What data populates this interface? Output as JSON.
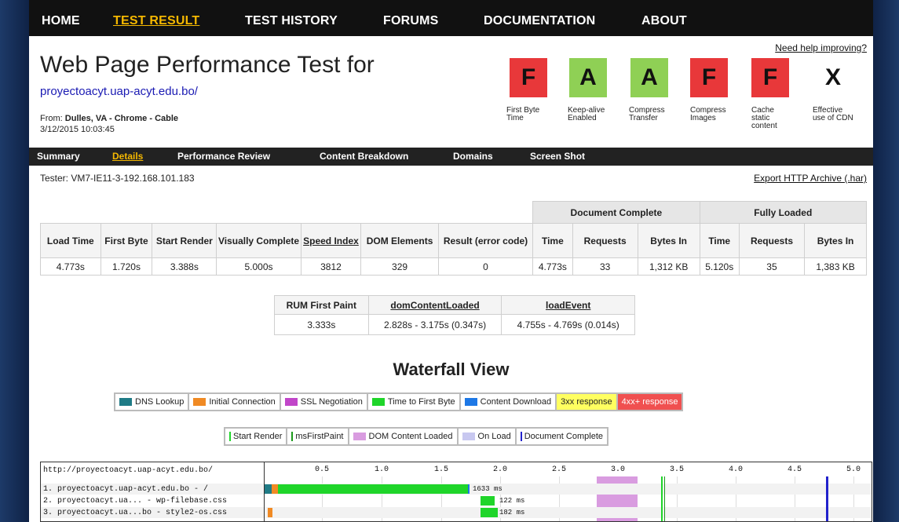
{
  "nav": {
    "home": "HOME",
    "test_result": "TEST RESULT",
    "test_history": "TEST HISTORY",
    "forums": "FORUMS",
    "documentation": "DOCUMENTATION",
    "about": "ABOUT"
  },
  "header": {
    "title": "Web Page Performance Test for",
    "url": "proyectoacyt.uap-acyt.edu.bo/",
    "from_label": "From: ",
    "from_value": "Dulles, VA - Chrome - Cable",
    "date": "3/12/2015 10:03:45",
    "help_link": "Need help improving?"
  },
  "grades": [
    {
      "grade": "F",
      "label": "First Byte Time",
      "color": "#e8383a"
    },
    {
      "grade": "A",
      "label": "Keep-alive Enabled",
      "color": "#8fd055"
    },
    {
      "grade": "A",
      "label": "Compress Transfer",
      "color": "#8fd055"
    },
    {
      "grade": "F",
      "label": "Compress Images",
      "color": "#e8383a"
    },
    {
      "grade": "F",
      "label": "Cache static content",
      "color": "#e8383a"
    },
    {
      "grade": "X",
      "label": "Effective use of CDN",
      "color": "#ffffff"
    }
  ],
  "subnav": {
    "summary": "Summary",
    "details": "Details",
    "performance_review": "Performance Review",
    "content_breakdown": "Content Breakdown",
    "domains": "Domains",
    "screen_shot": "Screen Shot"
  },
  "tester": "Tester: VM7-IE11-3-192.168.101.183",
  "export_link": "Export HTTP Archive (.har)",
  "results": {
    "group_doc": "Document Complete",
    "group_full": "Fully Loaded",
    "headers": {
      "load_time": "Load Time",
      "first_byte": "First Byte",
      "start_render": "Start Render",
      "visually_complete": "Visually Complete",
      "speed_index": "Speed Index",
      "dom_elements": "DOM Elements",
      "result": "Result (error code)",
      "time": "Time",
      "requests": "Requests",
      "bytes_in": "Bytes In"
    },
    "values": {
      "load_time": "4.773s",
      "first_byte": "1.720s",
      "start_render": "3.388s",
      "visually_complete": "5.000s",
      "speed_index": "3812",
      "dom_elements": "329",
      "result": "0",
      "doc_time": "4.773s",
      "doc_requests": "33",
      "doc_bytes": "1,312 KB",
      "full_time": "5.120s",
      "full_requests": "35",
      "full_bytes": "1,383 KB"
    }
  },
  "rum": {
    "h1": "RUM First Paint",
    "h2": "domContentLoaded",
    "h3": "loadEvent",
    "v1": "3.333s",
    "v2": "2.828s - 3.175s (0.347s)",
    "v3": "4.755s - 4.769s (0.014s)"
  },
  "waterfall": {
    "title": "Waterfall View",
    "legend1": [
      {
        "label": "DNS Lookup",
        "color": "#1f7b86"
      },
      {
        "label": "Initial Connection",
        "color": "#f08a24"
      },
      {
        "label": "SSL Negotiation",
        "color": "#c146c9"
      },
      {
        "label": "Time to First Byte",
        "color": "#1fd52a"
      },
      {
        "label": "Content Download",
        "color": "#1e78e6"
      }
    ],
    "legend_3xx": "3xx response",
    "legend_4xx": "4xx+ response",
    "legend2": {
      "start_render": "Start Render",
      "ms_first_paint": "msFirstPaint",
      "dom_content_loaded": "DOM Content Loaded",
      "on_load": "On Load",
      "doc_complete": "Document Complete"
    },
    "base_url": "http://proyectoacyt.uap-acyt.edu.bo/",
    "ticks": [
      "0.5",
      "1.0",
      "1.5",
      "2.0",
      "2.5",
      "3.0",
      "3.5",
      "4.0",
      "4.5",
      "5.0"
    ],
    "rows": [
      {
        "label": "1. proyectoacyt.uap-acyt.edu.bo - /",
        "ms": "1633 ms"
      },
      {
        "label": "2. proyectoacyt.ua... - wp-filebase.css",
        "ms": "122 ms"
      },
      {
        "label": "3. proyectoacyt.ua...bo - style2-os.css",
        "ms": "182 ms"
      }
    ]
  }
}
